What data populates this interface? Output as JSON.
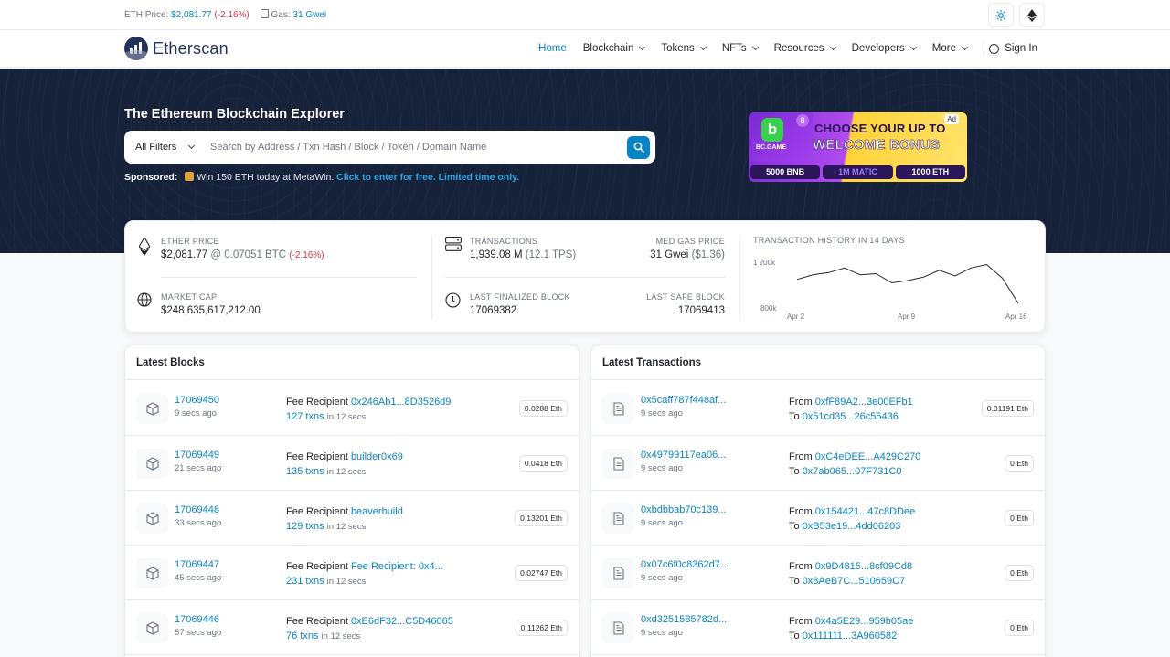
{
  "topbar": {
    "eth_price_label": "ETH Price:",
    "eth_price": "$2,081.77",
    "eth_change": "(-2.16%)",
    "gas_label": "Gas:",
    "gas_value": "31 Gwei"
  },
  "nav": {
    "logo": "Etherscan",
    "items": [
      {
        "label": "Home",
        "dropdown": false
      },
      {
        "label": "Blockchain",
        "dropdown": true
      },
      {
        "label": "Tokens",
        "dropdown": true
      },
      {
        "label": "NFTs",
        "dropdown": true
      },
      {
        "label": "Resources",
        "dropdown": true
      },
      {
        "label": "Developers",
        "dropdown": true
      },
      {
        "label": "More",
        "dropdown": true
      }
    ],
    "sign_in": "Sign In"
  },
  "hero": {
    "title": "The Ethereum Blockchain Explorer",
    "filter": "All Filters",
    "search_placeholder": "Search by Address / Txn Hash / Block / Token / Domain Name",
    "sponsored_label": "Sponsored:",
    "sponsored_text": "Win 150 ETH today at MetaWin.",
    "sponsored_cta": "Click to enter for free. Limited time only."
  },
  "ad": {
    "brand": "BC.GAME",
    "badge": "8",
    "line1": "CHOOSE YOUR UP TO",
    "line2": "WELCOME BONUS",
    "tag": "Ad",
    "pills": [
      "5000 BNB",
      "1M MATIC",
      "1000 ETH"
    ]
  },
  "stats": {
    "ether_price": {
      "label": "ETHER PRICE",
      "usd": "$2,081.77",
      "sep": "@",
      "btc": "0.07051 BTC",
      "change": "(-2.16%)"
    },
    "market_cap": {
      "label": "MARKET CAP",
      "value": "$248,635,617,212.00"
    },
    "transactions": {
      "label": "TRANSACTIONS",
      "value": "1,939.08 M",
      "tps": "(12.1 TPS)"
    },
    "med_gas": {
      "label": "MED GAS PRICE",
      "value": "31 Gwei",
      "usd": "($1.36)"
    },
    "last_finalized": {
      "label": "LAST FINALIZED BLOCK",
      "value": "17069382"
    },
    "last_safe": {
      "label": "LAST SAFE BLOCK",
      "value": "17069413"
    }
  },
  "chart_data": {
    "type": "line",
    "title": "TRANSACTION HISTORY IN 14 DAYS",
    "x_ticks": [
      "Apr 2",
      "Apr 9",
      "Apr 16"
    ],
    "y_ticks": [
      "1 200k",
      "800k"
    ],
    "ylim": [
      800000,
      1200000
    ],
    "x": [
      1,
      2,
      3,
      4,
      5,
      6,
      7,
      8,
      9,
      10,
      11,
      12,
      13,
      14,
      15
    ],
    "values": [
      1050000,
      1090000,
      1110000,
      1150000,
      1090000,
      1100000,
      1020000,
      1040000,
      1070000,
      1130000,
      1080000,
      1150000,
      1180000,
      1060000,
      840000
    ],
    "grid": false,
    "legend": false
  },
  "latest_blocks": {
    "title": "Latest Blocks",
    "recipient_label": "Fee Recipient",
    "in_label": "in 12 secs",
    "rows": [
      {
        "block": "17069450",
        "age": "9 secs ago",
        "recipient": "0x246Ab1...8D3526d9",
        "txns": "127 txns",
        "amount": "0.0288 Eth"
      },
      {
        "block": "17069449",
        "age": "21 secs ago",
        "recipient": "builder0x69",
        "txns": "135 txns",
        "amount": "0.0418 Eth"
      },
      {
        "block": "17069448",
        "age": "33 secs ago",
        "recipient": "beaverbuild",
        "txns": "129 txns",
        "amount": "0.13201 Eth"
      },
      {
        "block": "17069447",
        "age": "45 secs ago",
        "recipient": "Fee Recipient: 0x4...",
        "txns": "231 txns",
        "amount": "0.02747 Eth"
      },
      {
        "block": "17069446",
        "age": "57 secs ago",
        "recipient": "0xE6dF32...C5D46065",
        "txns": "76 txns",
        "amount": "0.11262 Eth"
      }
    ]
  },
  "latest_transactions": {
    "title": "Latest Transactions",
    "from_label": "From",
    "to_label": "To",
    "rows": [
      {
        "hash": "0x5caff787f448af...",
        "age": "9 secs ago",
        "from": "0xfF89A2...3e00EFb1",
        "to": "0x51cd35...26c55436",
        "amount": "0.01191 Eth"
      },
      {
        "hash": "0x49799117ea06...",
        "age": "9 secs ago",
        "from": "0xC4eDEE...A429C270",
        "to": "0x7ab065...07F731C0",
        "amount": "0 Eth"
      },
      {
        "hash": "0xbdbbab70c139...",
        "age": "9 secs ago",
        "from": "0x154421...47c8DDee",
        "to": "0xB53e19...4dd06203",
        "amount": "0 Eth"
      },
      {
        "hash": "0x07c6f0c8362d7...",
        "age": "9 secs ago",
        "from": "0x9D4815...8cf09Cd8",
        "to": "0x8AeB7C...510659C7",
        "amount": "0 Eth"
      },
      {
        "hash": "0xd3251585782d...",
        "age": "9 secs ago",
        "from": "0x4a5E29...959b05ae",
        "to": "0x111111...3A960582",
        "amount": "0 Eth"
      }
    ]
  },
  "colors": {
    "link": "#0784c3",
    "hero_bg": "#16213a",
    "negative": "#dc3545"
  }
}
